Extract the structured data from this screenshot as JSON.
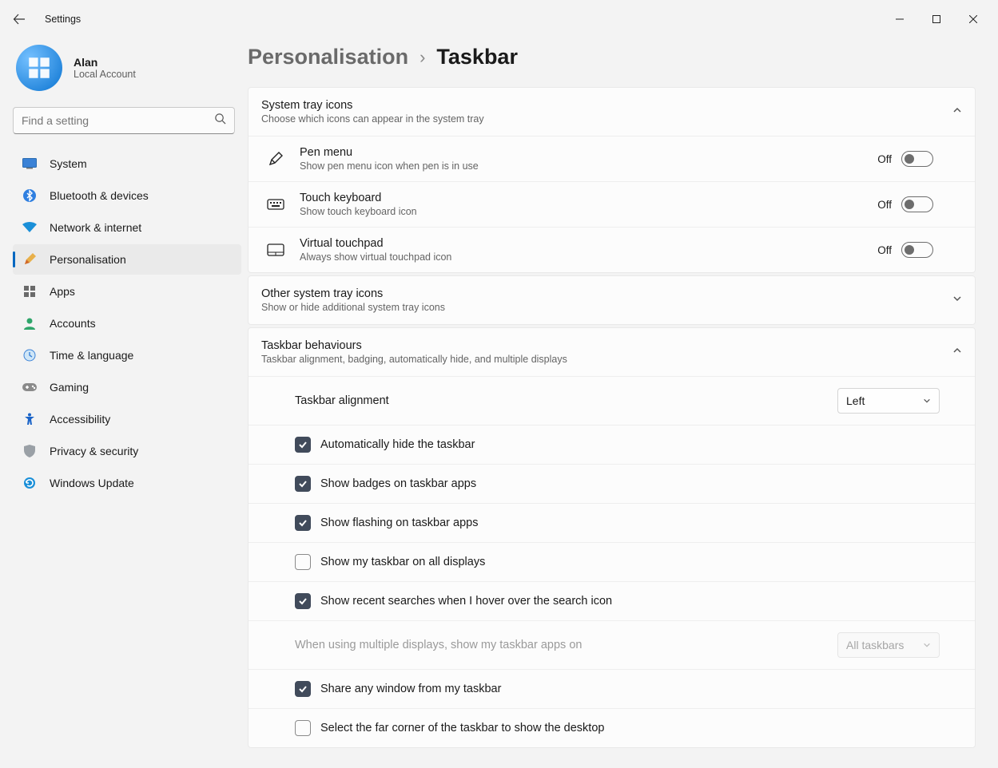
{
  "window": {
    "title": "Settings"
  },
  "profile": {
    "name": "Alan",
    "sub": "Local Account"
  },
  "search": {
    "placeholder": "Find a setting"
  },
  "nav": [
    {
      "key": "system",
      "label": "System"
    },
    {
      "key": "bluetooth",
      "label": "Bluetooth & devices"
    },
    {
      "key": "network",
      "label": "Network & internet"
    },
    {
      "key": "personalisation",
      "label": "Personalisation",
      "active": true
    },
    {
      "key": "apps",
      "label": "Apps"
    },
    {
      "key": "accounts",
      "label": "Accounts"
    },
    {
      "key": "time",
      "label": "Time & language"
    },
    {
      "key": "gaming",
      "label": "Gaming"
    },
    {
      "key": "accessibility",
      "label": "Accessibility"
    },
    {
      "key": "privacy",
      "label": "Privacy & security"
    },
    {
      "key": "update",
      "label": "Windows Update"
    }
  ],
  "breadcrumb": {
    "parent": "Personalisation",
    "current": "Taskbar"
  },
  "systray": {
    "title": "System tray icons",
    "desc": "Choose which icons can appear in the system tray",
    "items": [
      {
        "key": "pen",
        "title": "Pen menu",
        "desc": "Show pen menu icon when pen is in use",
        "state": "Off"
      },
      {
        "key": "touchkb",
        "title": "Touch keyboard",
        "desc": "Show touch keyboard icon",
        "state": "Off"
      },
      {
        "key": "touchpad",
        "title": "Virtual touchpad",
        "desc": "Always show virtual touchpad icon",
        "state": "Off"
      }
    ]
  },
  "othertray": {
    "title": "Other system tray icons",
    "desc": "Show or hide additional system tray icons"
  },
  "behaviours": {
    "title": "Taskbar behaviours",
    "desc": "Taskbar alignment, badging, automatically hide, and multiple displays",
    "alignment": {
      "label": "Taskbar alignment",
      "value": "Left"
    },
    "checks": [
      {
        "key": "autohide",
        "label": "Automatically hide the taskbar",
        "checked": true
      },
      {
        "key": "badges",
        "label": "Show badges on taskbar apps",
        "checked": true
      },
      {
        "key": "flashing",
        "label": "Show flashing on taskbar apps",
        "checked": true
      },
      {
        "key": "alldisplays",
        "label": "Show my taskbar on all displays",
        "checked": false
      },
      {
        "key": "recentsearch",
        "label": "Show recent searches when I hover over the search icon",
        "checked": true
      }
    ],
    "multidisplay": {
      "label": "When using multiple displays, show my taskbar apps on",
      "value": "All taskbars",
      "disabled": true
    },
    "checks2": [
      {
        "key": "shareany",
        "label": "Share any window from my taskbar",
        "checked": true
      },
      {
        "key": "farcorner",
        "label": "Select the far corner of the taskbar to show the desktop",
        "checked": false
      }
    ]
  }
}
